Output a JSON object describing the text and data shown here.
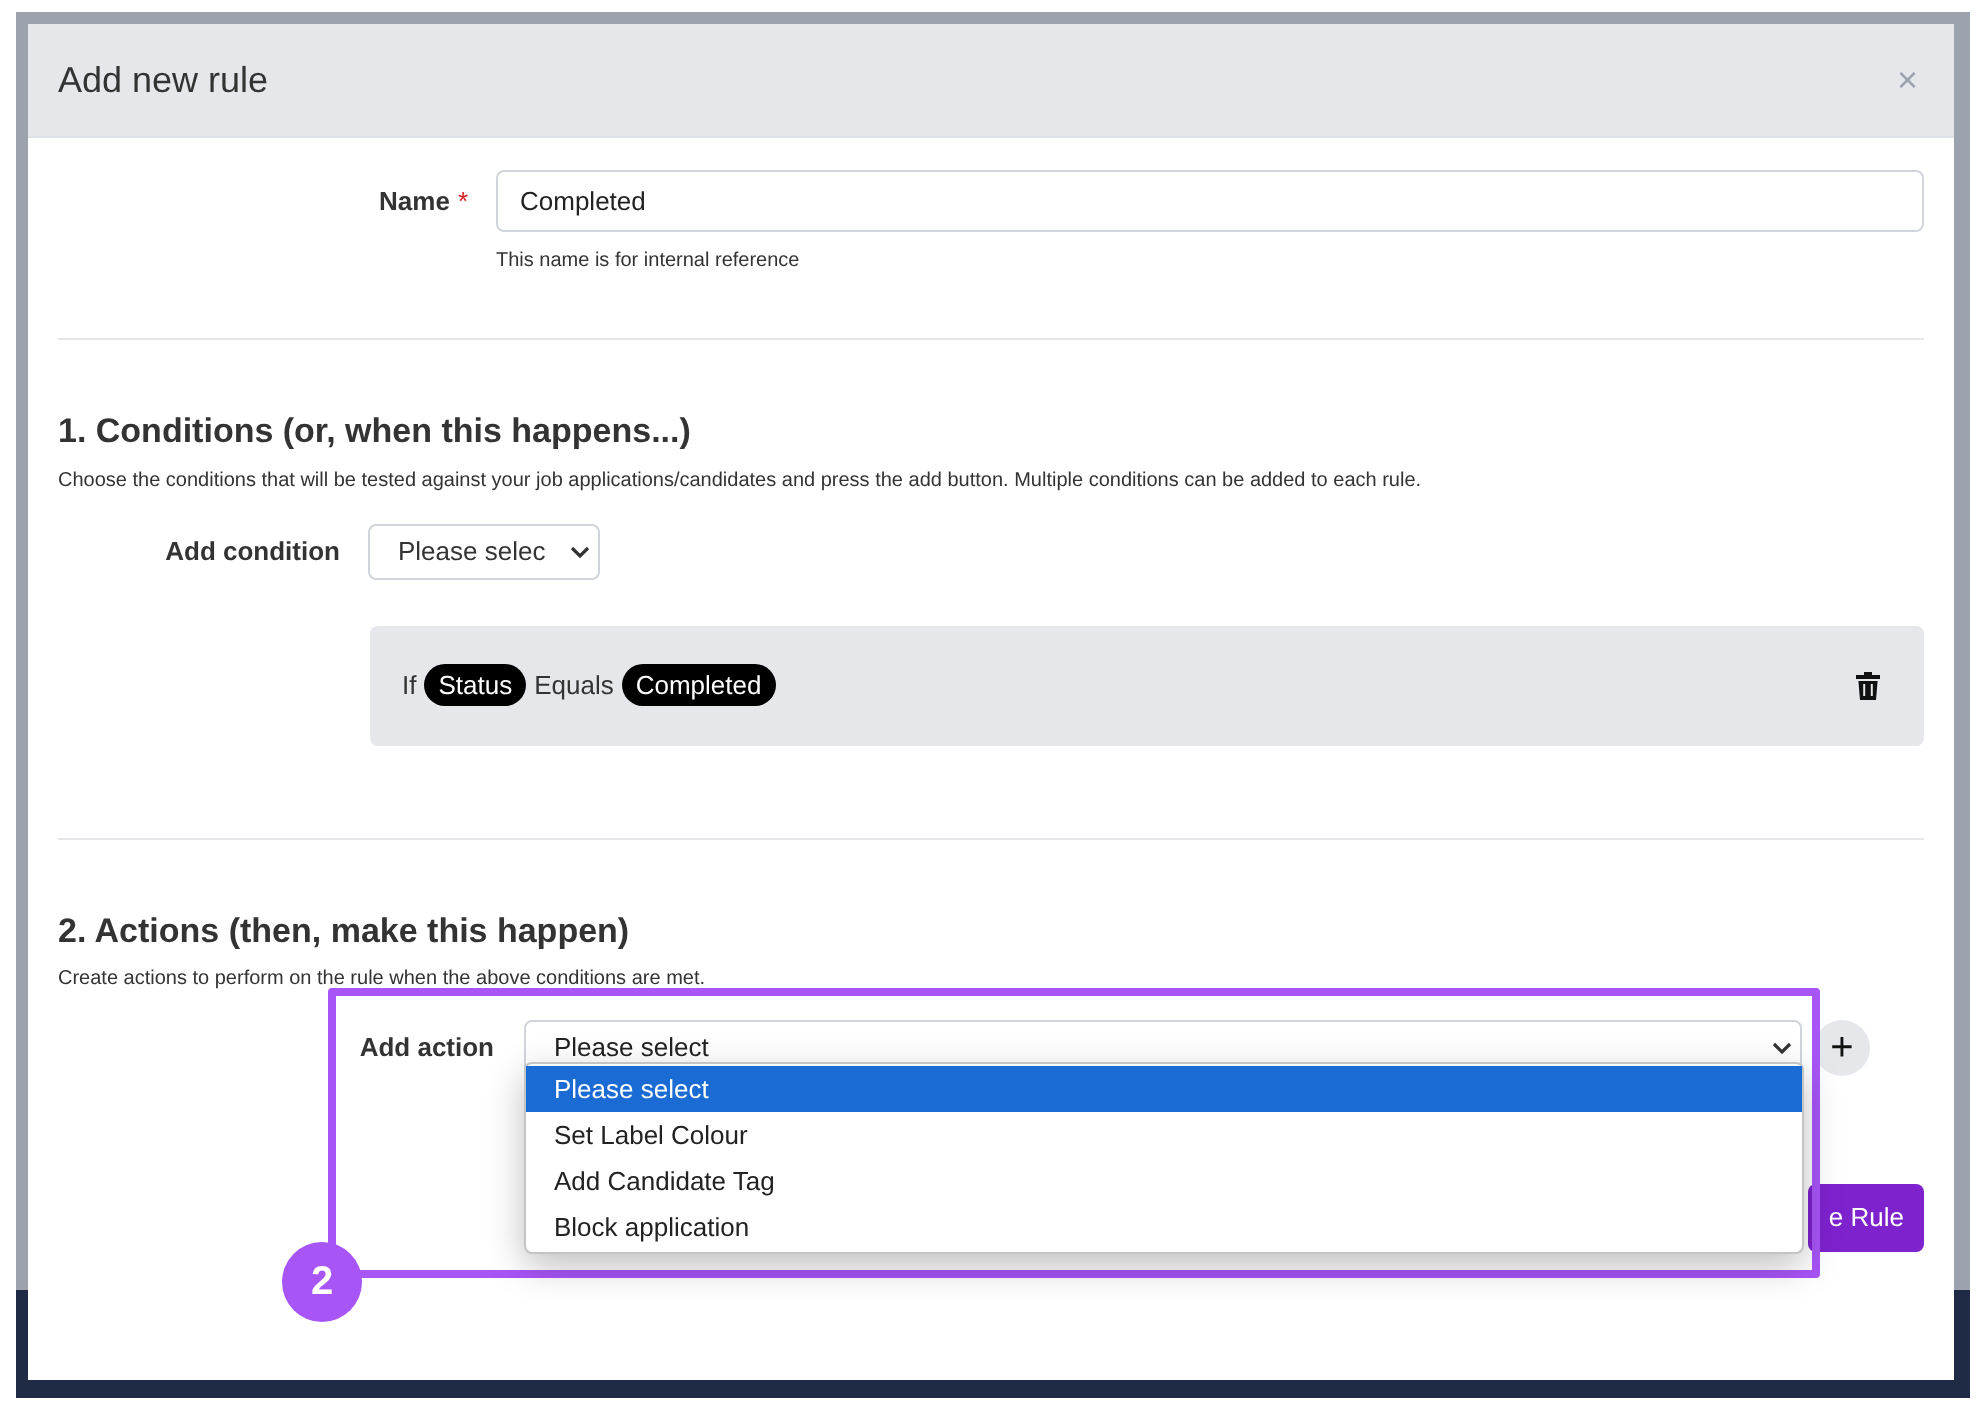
{
  "dialog": {
    "title": "Add new rule",
    "close": "×"
  },
  "name_field": {
    "label": "Name",
    "required_mark": "*",
    "value": "Completed",
    "hint": "This name is for internal reference"
  },
  "conditions": {
    "heading": "1. Conditions (or, when this happens...)",
    "description": "Choose the conditions that will be tested against your job applications/candidates and press the add button. Multiple conditions can be added to each rule.",
    "add_label": "Add condition",
    "select_value": "Please selec",
    "items": [
      {
        "prefix": "If",
        "field": "Status",
        "operator": "Equals",
        "value": "Completed"
      }
    ]
  },
  "actions": {
    "heading": "2. Actions (then, make this happen)",
    "description": "Create actions to perform on the rule when the above conditions are met.",
    "add_label": "Add action",
    "select_value": "Please select",
    "add_button": "+",
    "options": [
      {
        "label": "Please select",
        "selected": true
      },
      {
        "label": "Set Label Colour",
        "selected": false
      },
      {
        "label": "Add Candidate Tag",
        "selected": false
      },
      {
        "label": "Block application",
        "selected": false
      }
    ]
  },
  "save_button": "e Rule",
  "callout": "2"
}
